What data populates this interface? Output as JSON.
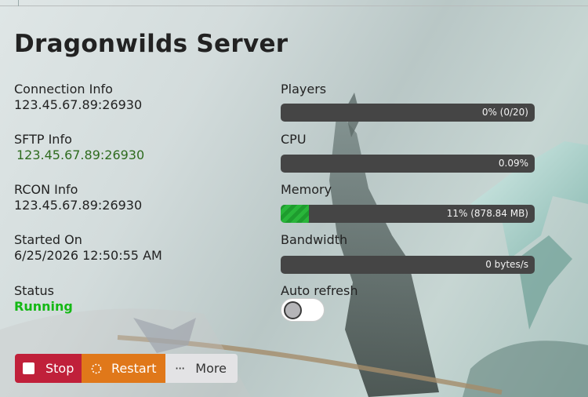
{
  "server": {
    "title": "Dragonwilds Server",
    "connection": {
      "label": "Connection Info",
      "value": "123.45.67.89:26930"
    },
    "sftp": {
      "label": "SFTP Info",
      "value": "123.45.67.89:26930"
    },
    "rcon": {
      "label": "RCON Info",
      "value": "123.45.67.89:26930"
    },
    "started": {
      "label": "Started On",
      "value": "6/25/2026 12:50:55 AM"
    },
    "status": {
      "label": "Status",
      "value": "Running"
    }
  },
  "metrics": {
    "players": {
      "label": "Players",
      "text": "0% (0/20)",
      "fraction": 0
    },
    "cpu": {
      "label": "CPU",
      "text": "0.09%",
      "fraction": 0.0009
    },
    "memory": {
      "label": "Memory",
      "text": "11% (878.84 MB)",
      "fraction": 0.11
    },
    "bandwidth": {
      "label": "Bandwidth",
      "text": "0 bytes/s",
      "fraction": 0
    }
  },
  "auto_refresh": {
    "label": "Auto refresh",
    "on": false
  },
  "actions": {
    "stop": {
      "label": "Stop",
      "color": "#c0203a"
    },
    "restart": {
      "label": "Restart",
      "color": "#e0781a"
    },
    "more": {
      "label": "More"
    }
  },
  "colors": {
    "running": "#14b814",
    "sftp_link": "#2e6b1e",
    "bar_track": "#454545",
    "bar_fill": "#1e9c2e"
  }
}
